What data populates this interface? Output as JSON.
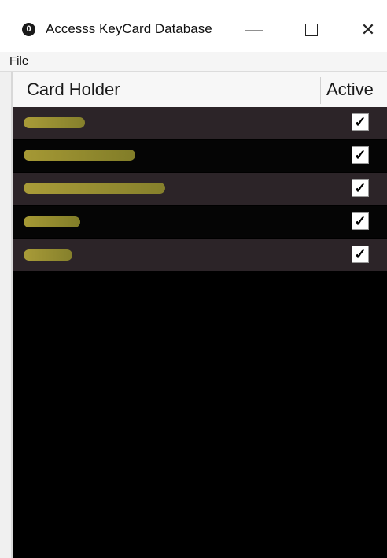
{
  "window": {
    "title": "Accesss KeyCard Database",
    "app_icon_glyph": "0",
    "minimize_glyph": "—",
    "close_glyph": "✕"
  },
  "menu": {
    "file_label": "File"
  },
  "table": {
    "columns": [
      "Card Holder",
      "Active"
    ],
    "rows": [
      {
        "active": true,
        "check_glyph": "✓"
      },
      {
        "active": true,
        "check_glyph": "✓"
      },
      {
        "active": true,
        "check_glyph": "✓"
      },
      {
        "active": true,
        "check_glyph": "✓"
      },
      {
        "active": true,
        "check_glyph": "✓"
      }
    ]
  },
  "colors": {
    "row_odd": "#2c2428",
    "row_even": "#050505",
    "redaction": "#b7a93a",
    "grid_background": "#000000"
  }
}
